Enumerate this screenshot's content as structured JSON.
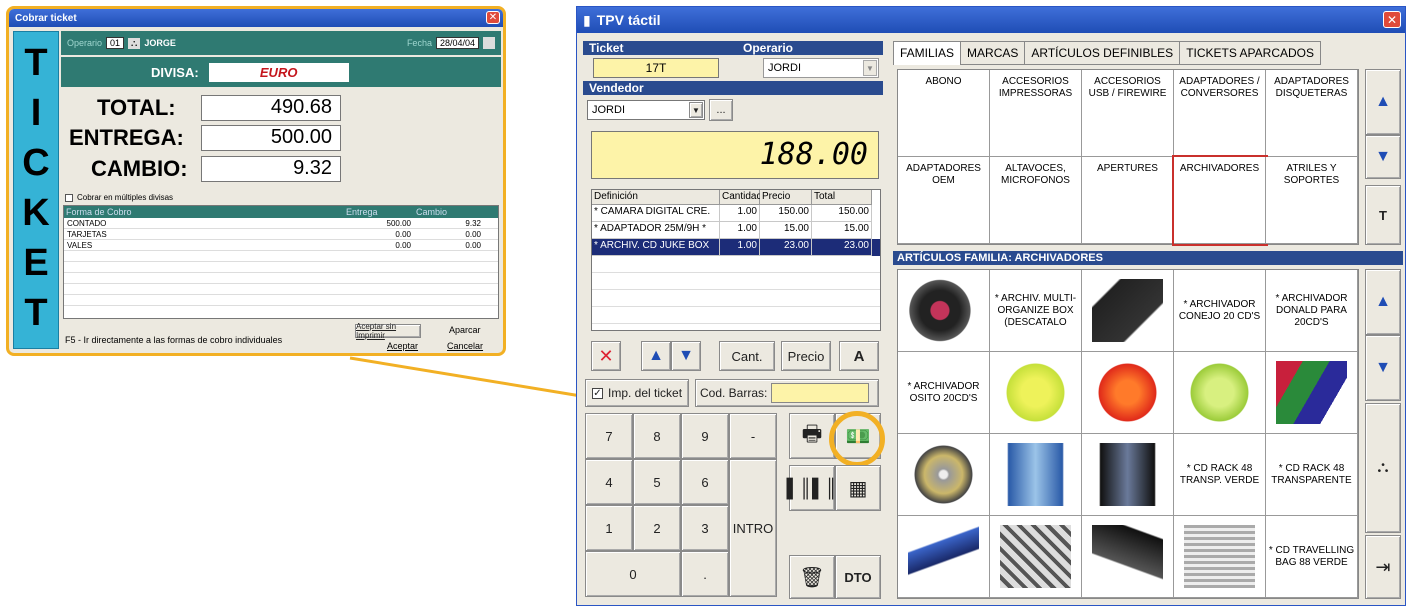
{
  "popup": {
    "title": "Cobrar ticket",
    "side_label": [
      "T",
      "I",
      "C",
      "K",
      "E",
      "T"
    ],
    "operario_label": "Operario",
    "operario_code": "01",
    "operario_name": "JORGE",
    "fecha_label": "Fecha",
    "fecha_value": "28/04/04",
    "divisa_label": "DIVISA:",
    "divisa_value": "EURO",
    "total_label": "TOTAL:",
    "total_value": "490.68",
    "entrega_label": "ENTREGA:",
    "entrega_value": "500.00",
    "cambio_label": "CAMBIO:",
    "cambio_value": "9.32",
    "multi_label": "Cobrar en múltiples divisas",
    "table_headers": [
      "Forma de Cobro",
      "Entrega",
      "Cambio"
    ],
    "rows": [
      {
        "forma": "CONTADO",
        "entrega": "500.00",
        "cambio": "9.32"
      },
      {
        "forma": "TARJETAS",
        "entrega": "0.00",
        "cambio": "0.00"
      },
      {
        "forma": "VALES",
        "entrega": "0.00",
        "cambio": "0.00"
      }
    ],
    "hint": "F5 - Ir directamente a las formas de cobro individuales",
    "btn_aceptar_sin": "Aceptar sin Imprimir",
    "btn_aparcar": "Aparcar",
    "btn_aceptar": "Aceptar",
    "btn_cancelar": "Cancelar"
  },
  "main": {
    "title": "TPV táctil",
    "ticket_label": "Ticket",
    "operario_label": "Operario",
    "ticket_value": "17T",
    "operario_value": "JORDI",
    "vendedor_label": "Vendedor",
    "vendedor_value": "JORDI",
    "dots_btn": "...",
    "total_display": "188.00",
    "lines_headers": [
      "Definición",
      "Cantidad",
      "Precio",
      "Total"
    ],
    "lines": [
      {
        "def": "* CAMARA DIGITAL CRE.",
        "qty": "1.00",
        "price": "150.00",
        "total": "150.00",
        "selected": false
      },
      {
        "def": "* ADAPTADOR 25M/9H *",
        "qty": "1.00",
        "price": "15.00",
        "total": "15.00",
        "selected": false
      },
      {
        "def": "* ARCHIV. CD JUKE BOX",
        "qty": "1.00",
        "price": "23.00",
        "total": "23.00",
        "selected": true
      }
    ],
    "cant_btn": "Cant.",
    "precio_btn": "Precio",
    "a_btn": "A",
    "imp_label": "Imp. del ticket",
    "barcode_label": "Cod. Barras:",
    "keys": [
      "7",
      "8",
      "9",
      "-",
      "4",
      "5",
      "6",
      "1",
      "2",
      "3",
      "0",
      "."
    ],
    "intro_label": "INTRO",
    "dto_label": "DTO",
    "tabs": [
      "FAMILIAS",
      "MARCAS",
      "ARTÍCULOS DEFINIBLES",
      "TICKETS APARCADOS"
    ],
    "families": [
      "ABONO",
      "ACCESORIOS IMPRESSORAS",
      "ACCESORIOS USB / FIREWIRE",
      "ADAPTADORES / CONVERSORES",
      "ADAPTADORES DISQUETERAS",
      "ADAPTADORES OEM",
      "ALTAVOCES, MICROFONOS",
      "APERTURES",
      "ARCHIVADORES",
      "ATRILES Y SOPORTES"
    ],
    "t_btn": "T",
    "articles_header": "ARTÍCULOS FAMILIA: ARCHIVADORES",
    "articles": [
      {
        "text": "",
        "img": "cd-tower"
      },
      {
        "text": "* ARCHIV. MULTI-ORGANIZE BOX (DESCATALO",
        "img": ""
      },
      {
        "text": "",
        "img": "black-case"
      },
      {
        "text": "* ARCHIVADOR CONEJO 20 CD'S",
        "img": ""
      },
      {
        "text": "* ARCHIVADOR DONALD PARA 20CD'S",
        "img": ""
      },
      {
        "text": "* ARCHIVADOR OSITO 20CD'S",
        "img": ""
      },
      {
        "text": "",
        "img": "yellow-case"
      },
      {
        "text": "",
        "img": "red-case"
      },
      {
        "text": "",
        "img": "green-case"
      },
      {
        "text": "",
        "img": "color-cases"
      },
      {
        "text": "",
        "img": "cd-disc"
      },
      {
        "text": "",
        "img": "cd-rack-blue"
      },
      {
        "text": "",
        "img": "cd-rack-black"
      },
      {
        "text": "* CD RACK 48 TRANSP. VERDE",
        "img": ""
      },
      {
        "text": "* CD RACK 48 TRANSPARENTE",
        "img": ""
      },
      {
        "text": "",
        "img": "blue-stand"
      },
      {
        "text": "",
        "img": "spinner-rack"
      },
      {
        "text": "",
        "img": "black-rack"
      },
      {
        "text": "",
        "img": "cd-stack"
      },
      {
        "text": "* CD TRAVELLING BAG 88 VERDE",
        "img": ""
      }
    ]
  }
}
